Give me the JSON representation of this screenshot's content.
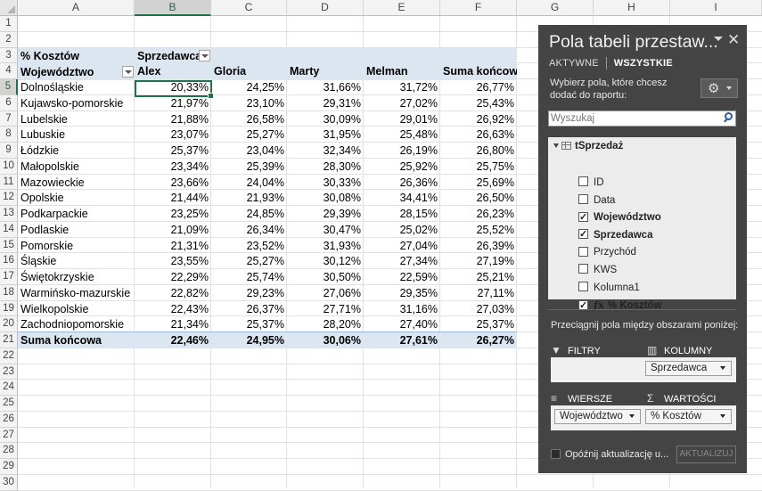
{
  "sheet": {
    "columns": [
      "A",
      "B",
      "C",
      "D",
      "E",
      "F",
      "G",
      "H",
      "I"
    ],
    "rows": [
      "1",
      "2",
      "3",
      "4",
      "5",
      "6",
      "7",
      "8",
      "9",
      "10",
      "11",
      "12",
      "13",
      "14",
      "15",
      "16",
      "17",
      "18",
      "19",
      "20",
      "21",
      "22",
      "23",
      "24",
      "25",
      "26",
      "27",
      "28",
      "29",
      "30"
    ],
    "selected_column": "B",
    "selected_row": "5"
  },
  "pivot": {
    "value_label": "% Kosztów",
    "column_field_label": "Sprzedawca",
    "row_field_label": "Województwo",
    "column_headers": [
      "Alex",
      "Gloria",
      "Marty",
      "Melman",
      "Suma końcowa"
    ],
    "rows": [
      {
        "label": "Dolnośląskie",
        "values": [
          "20,33%",
          "24,25%",
          "31,66%",
          "31,72%",
          "26,77%"
        ]
      },
      {
        "label": "Kujawsko-pomorskie",
        "values": [
          "21,97%",
          "23,10%",
          "29,31%",
          "27,02%",
          "25,43%"
        ]
      },
      {
        "label": "Lubelskie",
        "values": [
          "21,88%",
          "26,58%",
          "30,09%",
          "29,01%",
          "26,92%"
        ]
      },
      {
        "label": "Lubuskie",
        "values": [
          "23,07%",
          "25,27%",
          "31,95%",
          "25,48%",
          "26,63%"
        ]
      },
      {
        "label": "Łódzkie",
        "values": [
          "25,37%",
          "23,04%",
          "32,34%",
          "26,19%",
          "26,80%"
        ]
      },
      {
        "label": "Małopolskie",
        "values": [
          "23,34%",
          "25,39%",
          "28,30%",
          "25,92%",
          "25,75%"
        ]
      },
      {
        "label": "Mazowieckie",
        "values": [
          "23,66%",
          "24,04%",
          "30,33%",
          "26,36%",
          "25,69%"
        ]
      },
      {
        "label": "Opolskie",
        "values": [
          "21,44%",
          "21,93%",
          "30,08%",
          "34,41%",
          "26,50%"
        ]
      },
      {
        "label": "Podkarpackie",
        "values": [
          "23,25%",
          "24,85%",
          "29,39%",
          "28,15%",
          "26,23%"
        ]
      },
      {
        "label": "Podlaskie",
        "values": [
          "21,09%",
          "26,34%",
          "30,47%",
          "25,02%",
          "25,52%"
        ]
      },
      {
        "label": "Pomorskie",
        "values": [
          "21,31%",
          "23,52%",
          "31,93%",
          "27,04%",
          "26,39%"
        ]
      },
      {
        "label": "Śląskie",
        "values": [
          "23,55%",
          "25,27%",
          "30,12%",
          "27,34%",
          "27,19%"
        ]
      },
      {
        "label": "Świętokrzyskie",
        "values": [
          "22,29%",
          "25,74%",
          "30,50%",
          "22,59%",
          "25,21%"
        ]
      },
      {
        "label": "Warmińsko-mazurskie",
        "values": [
          "22,82%",
          "29,23%",
          "27,06%",
          "29,35%",
          "27,11%"
        ]
      },
      {
        "label": "Wielkopolskie",
        "values": [
          "22,43%",
          "26,37%",
          "27,71%",
          "31,16%",
          "27,03%"
        ]
      },
      {
        "label": "Zachodniopomorskie",
        "values": [
          "21,34%",
          "25,37%",
          "28,20%",
          "27,40%",
          "25,37%"
        ]
      }
    ],
    "total": {
      "label": "Suma końcowa",
      "values": [
        "22,46%",
        "24,95%",
        "30,06%",
        "27,61%",
        "26,27%"
      ]
    }
  },
  "pane": {
    "title": "Pola tabeli przestaw...",
    "close_glyph": "✕",
    "tabs": [
      "AKTYWNE",
      "WSZYSTKIE"
    ],
    "active_tab": "WSZYSTKIE",
    "choose_text": "Wybierz pola, które chcesz dodać do raportu:",
    "gear_glyph": "⚙",
    "search_placeholder": "Wyszukaj",
    "table_name": "tSprzedaż",
    "fields": [
      {
        "name": "ID",
        "checked": false
      },
      {
        "name": "Data",
        "checked": false
      },
      {
        "name": "Województwo",
        "checked": true
      },
      {
        "name": "Sprzedawca",
        "checked": true
      },
      {
        "name": "Przychód",
        "checked": false
      },
      {
        "name": "KWS",
        "checked": false
      },
      {
        "name": "Kolumna1",
        "checked": false
      },
      {
        "name": "% Kosztów",
        "checked": true,
        "calculated": true
      }
    ],
    "fx_glyph": "fx",
    "drag_text": "Przeciągnij pola między obszarami poniżej:",
    "areas": {
      "filters": {
        "label": "FILTRY",
        "icon": "▼",
        "item": ""
      },
      "columns": {
        "label": "KOLUMNY",
        "icon": "▥",
        "item": "Sprzedawca"
      },
      "rows": {
        "label": "WIERSZE",
        "icon": "≡",
        "item": "Województwo"
      },
      "values": {
        "label": "WARTOŚCI",
        "icon": "Σ",
        "item": "% Kosztów"
      }
    },
    "defer_label": "Opóźnij aktualizację u...",
    "update_label": "AKTUALIZUJ"
  },
  "colors": {
    "band": "#dce6f1",
    "accent": "#217346",
    "pane_bg": "#444444"
  }
}
